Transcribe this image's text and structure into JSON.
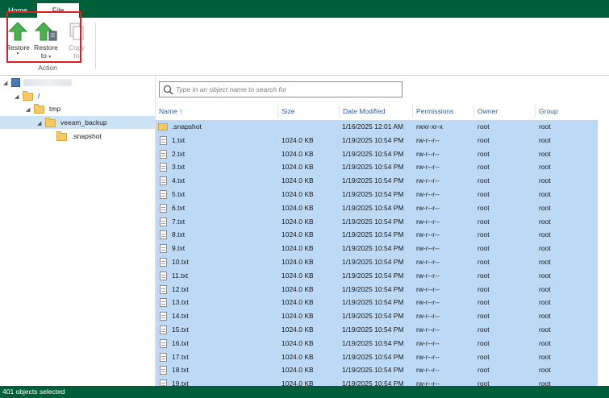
{
  "tabs": {
    "home": "Home",
    "file": "File"
  },
  "ribbon": {
    "restore_line1": "Restore",
    "restore_to_line1": "Restore",
    "restore_to_line2": "to",
    "copy_line1": "Copy",
    "copy_line2": "to",
    "group_label": "Action"
  },
  "tree": {
    "root_label": "/",
    "tmp_label": "tmp",
    "veeam_label": "veeam_backup",
    "snapshot_label": ".snapshot"
  },
  "search": {
    "placeholder": "Type in an object name to search for"
  },
  "columns": {
    "name": "Name ↑",
    "size": "Size",
    "modified": "Date Modified",
    "permissions": "Permissions",
    "owner": "Owner",
    "group": "Group"
  },
  "rows": [
    {
      "name": ".snapshot",
      "size": "",
      "modified": "1/16/2025 12:01 AM",
      "permissions": "rwxr-xr-x",
      "owner": "root",
      "group": "root",
      "icon": "folder-icon"
    },
    {
      "name": "1.txt",
      "size": "1024.0 KB",
      "modified": "1/19/2025 10:54 PM",
      "permissions": "rw-r--r--",
      "owner": "root",
      "group": "root",
      "icon": "text-file-icon"
    },
    {
      "name": "2.txt",
      "size": "1024.0 KB",
      "modified": "1/19/2025 10:54 PM",
      "permissions": "rw-r--r--",
      "owner": "root",
      "group": "root",
      "icon": "text-file-icon"
    },
    {
      "name": "3.txt",
      "size": "1024.0 KB",
      "modified": "1/19/2025 10:54 PM",
      "permissions": "rw-r--r--",
      "owner": "root",
      "group": "root",
      "icon": "text-file-icon"
    },
    {
      "name": "4.txt",
      "size": "1024.0 KB",
      "modified": "1/19/2025 10:54 PM",
      "permissions": "rw-r--r--",
      "owner": "root",
      "group": "root",
      "icon": "text-file-icon"
    },
    {
      "name": "5.txt",
      "size": "1024.0 KB",
      "modified": "1/19/2025 10:54 PM",
      "permissions": "rw-r--r--",
      "owner": "root",
      "group": "root",
      "icon": "text-file-icon"
    },
    {
      "name": "6.txt",
      "size": "1024.0 KB",
      "modified": "1/19/2025 10:54 PM",
      "permissions": "rw-r--r--",
      "owner": "root",
      "group": "root",
      "icon": "text-file-icon"
    },
    {
      "name": "7.txt",
      "size": "1024.0 KB",
      "modified": "1/19/2025 10:54 PM",
      "permissions": "rw-r--r--",
      "owner": "root",
      "group": "root",
      "icon": "text-file-icon"
    },
    {
      "name": "8.txt",
      "size": "1024.0 KB",
      "modified": "1/19/2025 10:54 PM",
      "permissions": "rw-r--r--",
      "owner": "root",
      "group": "root",
      "icon": "text-file-icon"
    },
    {
      "name": "9.txt",
      "size": "1024.0 KB",
      "modified": "1/19/2025 10:54 PM",
      "permissions": "rw-r--r--",
      "owner": "root",
      "group": "root",
      "icon": "text-file-icon"
    },
    {
      "name": "10.txt",
      "size": "1024.0 KB",
      "modified": "1/19/2025 10:54 PM",
      "permissions": "rw-r--r--",
      "owner": "root",
      "group": "root",
      "icon": "text-file-icon"
    },
    {
      "name": "11.txt",
      "size": "1024.0 KB",
      "modified": "1/19/2025 10:54 PM",
      "permissions": "rw-r--r--",
      "owner": "root",
      "group": "root",
      "icon": "text-file-icon"
    },
    {
      "name": "12.txt",
      "size": "1024.0 KB",
      "modified": "1/19/2025 10:54 PM",
      "permissions": "rw-r--r--",
      "owner": "root",
      "group": "root",
      "icon": "text-file-icon"
    },
    {
      "name": "13.txt",
      "size": "1024.0 KB",
      "modified": "1/19/2025 10:54 PM",
      "permissions": "rw-r--r--",
      "owner": "root",
      "group": "root",
      "icon": "text-file-icon"
    },
    {
      "name": "14.txt",
      "size": "1024.0 KB",
      "modified": "1/19/2025 10:54 PM",
      "permissions": "rw-r--r--",
      "owner": "root",
      "group": "root",
      "icon": "text-file-icon"
    },
    {
      "name": "15.txt",
      "size": "1024.0 KB",
      "modified": "1/19/2025 10:54 PM",
      "permissions": "rw-r--r--",
      "owner": "root",
      "group": "root",
      "icon": "text-file-icon"
    },
    {
      "name": "16.txt",
      "size": "1024.0 KB",
      "modified": "1/19/2025 10:54 PM",
      "permissions": "rw-r--r--",
      "owner": "root",
      "group": "root",
      "icon": "text-file-icon"
    },
    {
      "name": "17.txt",
      "size": "1024.0 KB",
      "modified": "1/19/2025 10:54 PM",
      "permissions": "rw-r--r--",
      "owner": "root",
      "group": "root",
      "icon": "text-file-icon"
    },
    {
      "name": "18.txt",
      "size": "1024.0 KB",
      "modified": "1/19/2025 10:54 PM",
      "permissions": "rw-r--r--",
      "owner": "root",
      "group": "root",
      "icon": "text-file-icon"
    },
    {
      "name": "19.txt",
      "size": "1024.0 KB",
      "modified": "1/19/2025 10:54 PM",
      "permissions": "rw-r--r--",
      "owner": "root",
      "group": "root",
      "icon": "text-file-icon"
    }
  ],
  "status": {
    "text": "401 objects selected"
  },
  "colors": {
    "brand_green": "#005f3b",
    "selection_blue": "#bcd9f5",
    "tree_selection": "#cde4f7",
    "header_text": "#2b5ea0",
    "annotation_red": "#e31b23",
    "restore_arrow_green": "#4caf50"
  }
}
